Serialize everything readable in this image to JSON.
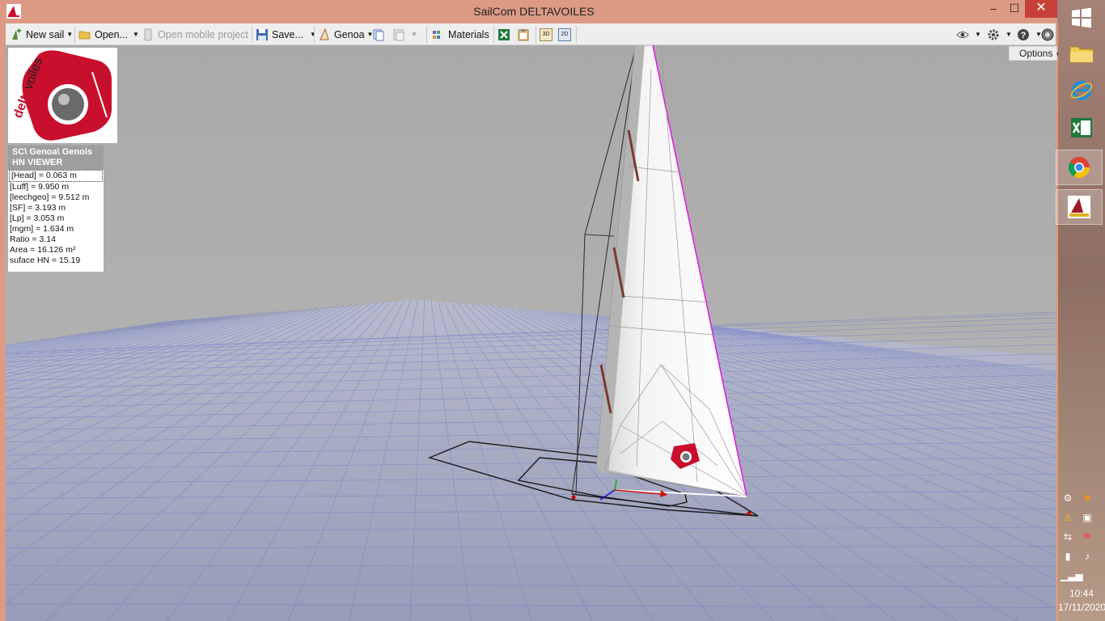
{
  "window": {
    "title": "SailCom DELTAVOILES",
    "minimize": "–",
    "maximize": "☐",
    "close": "✕"
  },
  "toolbar": {
    "new_sail": "New sail",
    "open": "Open...",
    "open_mobile": "Open mobile project",
    "save": "Save...",
    "genoa": "Genoa",
    "materials": "Materials",
    "btn_3d": "3D",
    "btn_2d": "2D"
  },
  "options_tip": "Options",
  "logo": {
    "text_a": "delta",
    "text_b": "voiles"
  },
  "info": {
    "header_line1": "SC\\ Genoa\\ Genois",
    "header_line2": "HN VIEWER",
    "lines": [
      "[Head] = 0.063 m",
      "[Luff] = 9.950 m",
      "[leechgeo] = 9.512 m",
      "[SF] = 3.193 m",
      "[Lp] = 3.053 m",
      "[mgm] = 1.634 m",
      "Ratio = 3.14",
      "Area = 16.126 m²",
      "suface HN = 15.19"
    ]
  },
  "taskbar": {
    "time": "10:44",
    "date": "17/11/2020"
  },
  "colors": {
    "titlebar": "#dc9a84",
    "close": "#c7413a",
    "brand_red": "#c8102e",
    "grid": "#5a6fd0"
  }
}
